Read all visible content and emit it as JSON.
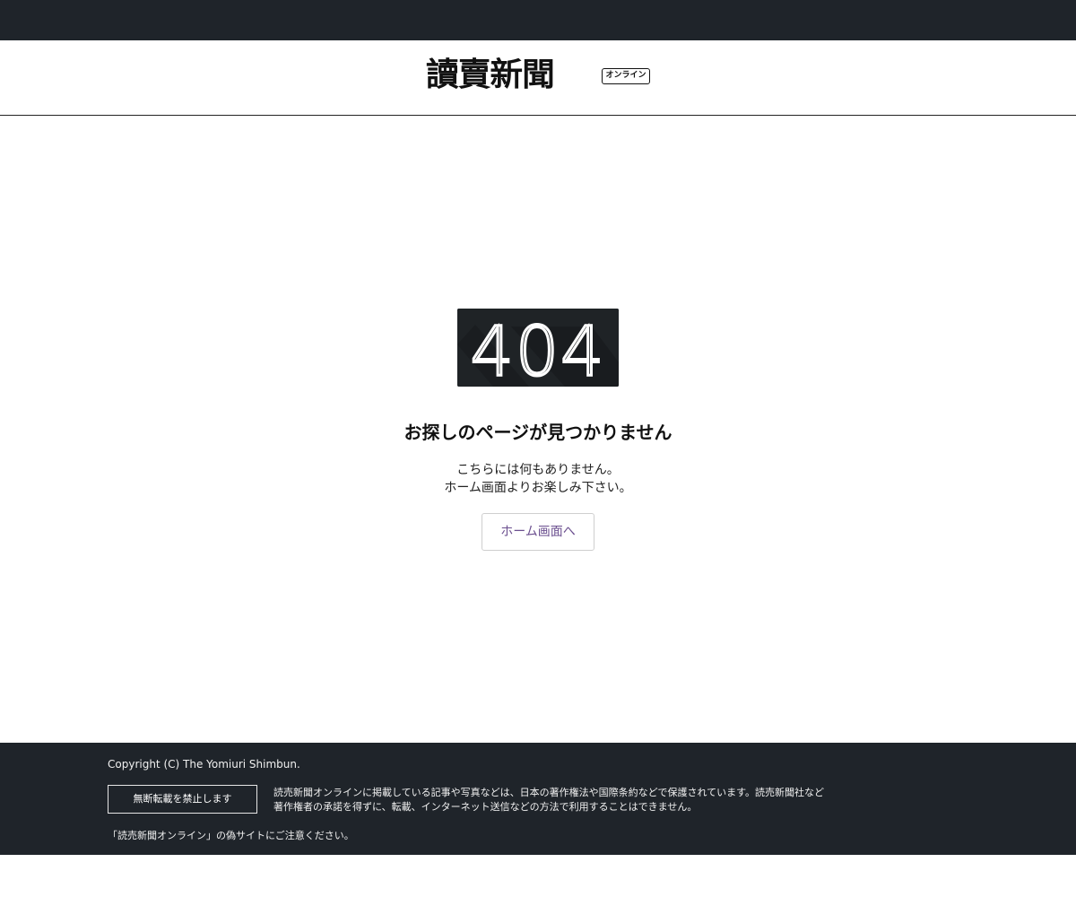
{
  "header": {
    "logo_text": "讀賣新聞",
    "online_badge": "オンライン"
  },
  "error": {
    "code": "404",
    "title": "お探しのページが見つかりません",
    "description_line1": "こちらには何もありません。",
    "description_line2": "ホーム画面よりお楽しみ下さい。",
    "home_button_label": "ホーム画面へ"
  },
  "footer": {
    "copyright": "Copyright (C) The Yomiuri Shimbun.",
    "no_reproduction_button": "無断転載を禁止します",
    "notice_line1": "読売新聞オンラインに掲載している記事や写真などは、日本の著作権法や国際条約などで保護されています。読売新聞社など",
    "notice_line2": "著作権者の承諾を得ずに、転載、インターネット送信などの方法で利用することはできません。",
    "fake_site_warning": "「読売新聞オンライン」の偽サイトにご注意ください。"
  },
  "colors": {
    "dark_bar": "#1f242a",
    "error_box": "#1f2326",
    "link_purple": "#6b4f8f"
  }
}
